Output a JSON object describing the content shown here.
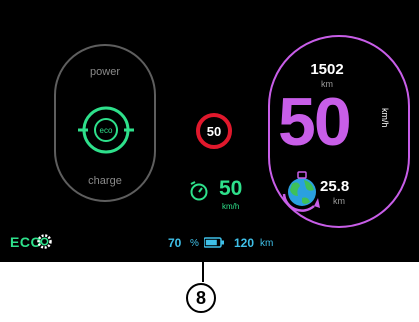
{
  "power_gauge": {
    "top_label": "power",
    "bottom_label": "charge",
    "center_label": "eco"
  },
  "speed_limit": {
    "value": "50"
  },
  "cruise": {
    "speed": "50",
    "unit": "km/h"
  },
  "speedometer": {
    "odometer": "1502",
    "odometer_unit": "km",
    "speed": "50",
    "speed_unit": "km/h",
    "eco_saved": "25.8",
    "eco_saved_unit": "km"
  },
  "status_bar": {
    "drive_mode": "ECO",
    "battery_percent": "70",
    "battery_percent_symbol": "%",
    "range": "120",
    "range_unit": "km"
  },
  "callout": {
    "number": "8"
  },
  "colors": {
    "green": "#2ee08b",
    "purple": "#c85ee8",
    "red": "#e0182c",
    "cyan": "#3fc0e8"
  }
}
